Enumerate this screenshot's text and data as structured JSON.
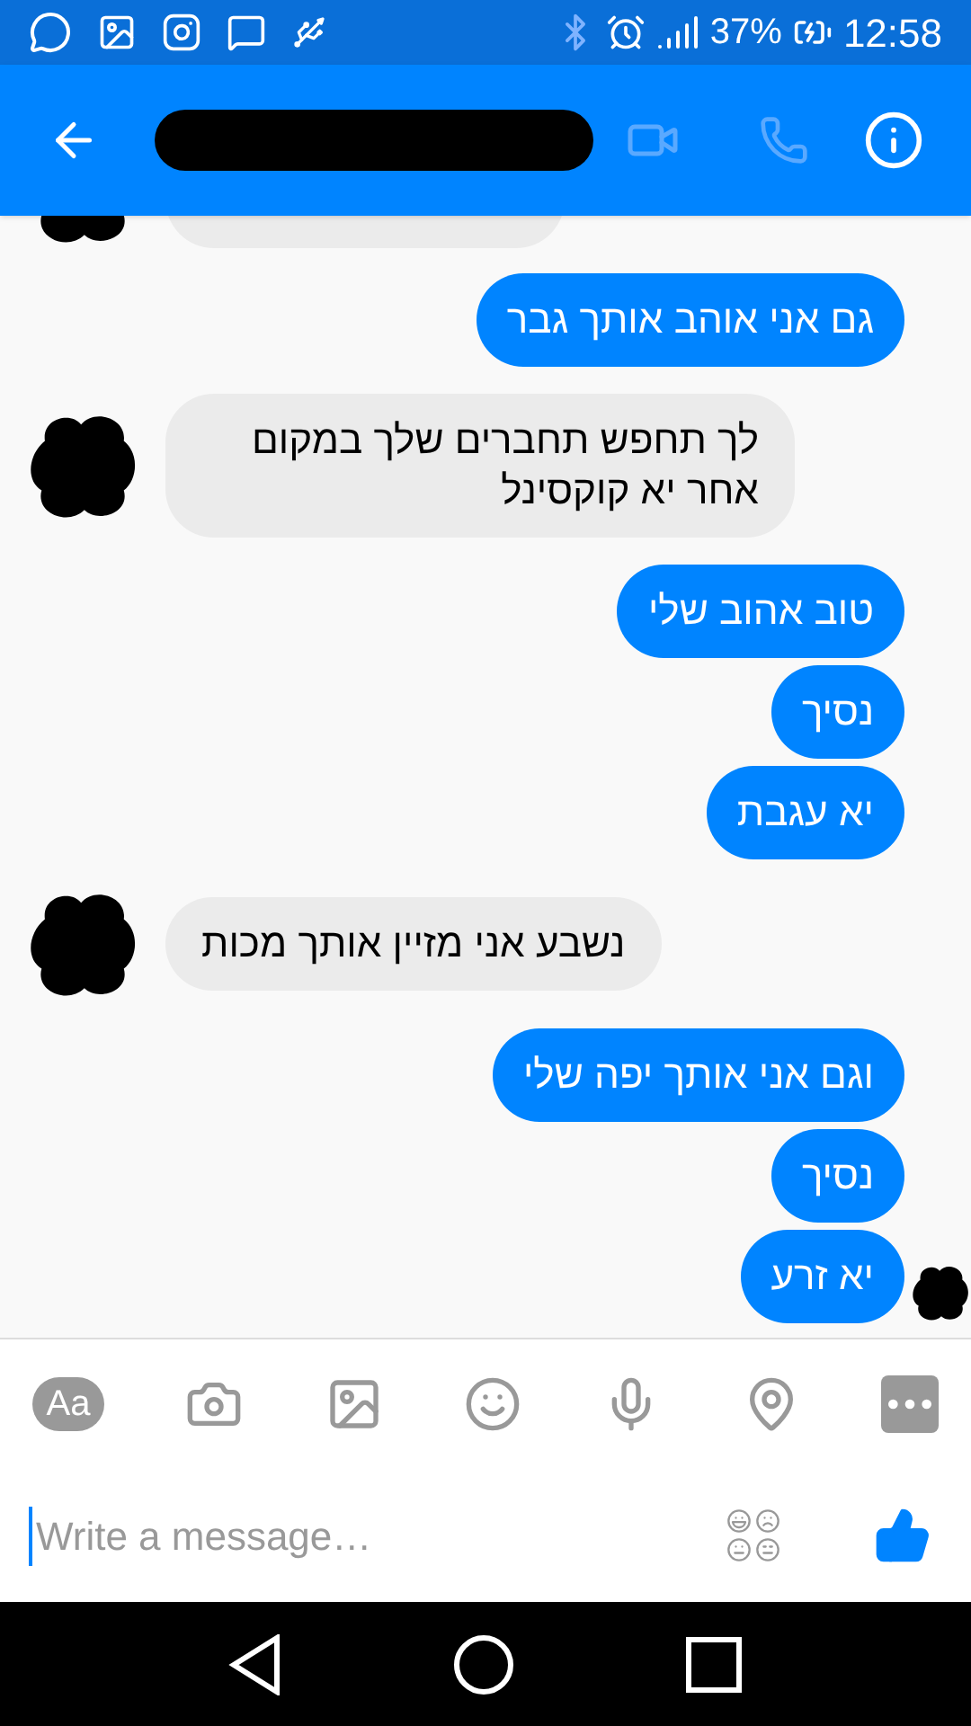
{
  "status_bar": {
    "battery": "37%",
    "time": "12:58"
  },
  "header": {
    "name_redacted": true
  },
  "messages": [
    {
      "kind": "received",
      "avatar": true,
      "cut": true
    },
    {
      "kind": "sent",
      "text": "גם אני אוהב אותך גבר",
      "seen_marker": false
    },
    {
      "kind": "received",
      "text": "לך תחפש תחברים שלך במקום אחר יא קוקסינל",
      "avatar": true
    },
    {
      "kind": "sent",
      "text": "טוב אהוב שלי",
      "seen_marker": false
    },
    {
      "kind": "sent",
      "text": "נסיך",
      "seen_marker": false
    },
    {
      "kind": "sent",
      "text": "יא עגבת",
      "seen_marker": false
    },
    {
      "kind": "received",
      "text": "נשבע אני מזיין אותך מכות",
      "avatar": true
    },
    {
      "kind": "sent",
      "text": "וגם אני אותך יפה שלי",
      "seen_marker": false
    },
    {
      "kind": "sent",
      "text": "נסיך",
      "seen_marker": false
    },
    {
      "kind": "sent",
      "text": "יא זרע",
      "seen_marker": true
    }
  ],
  "composer": {
    "text_button": "Aa",
    "placeholder": "Write a message…"
  }
}
